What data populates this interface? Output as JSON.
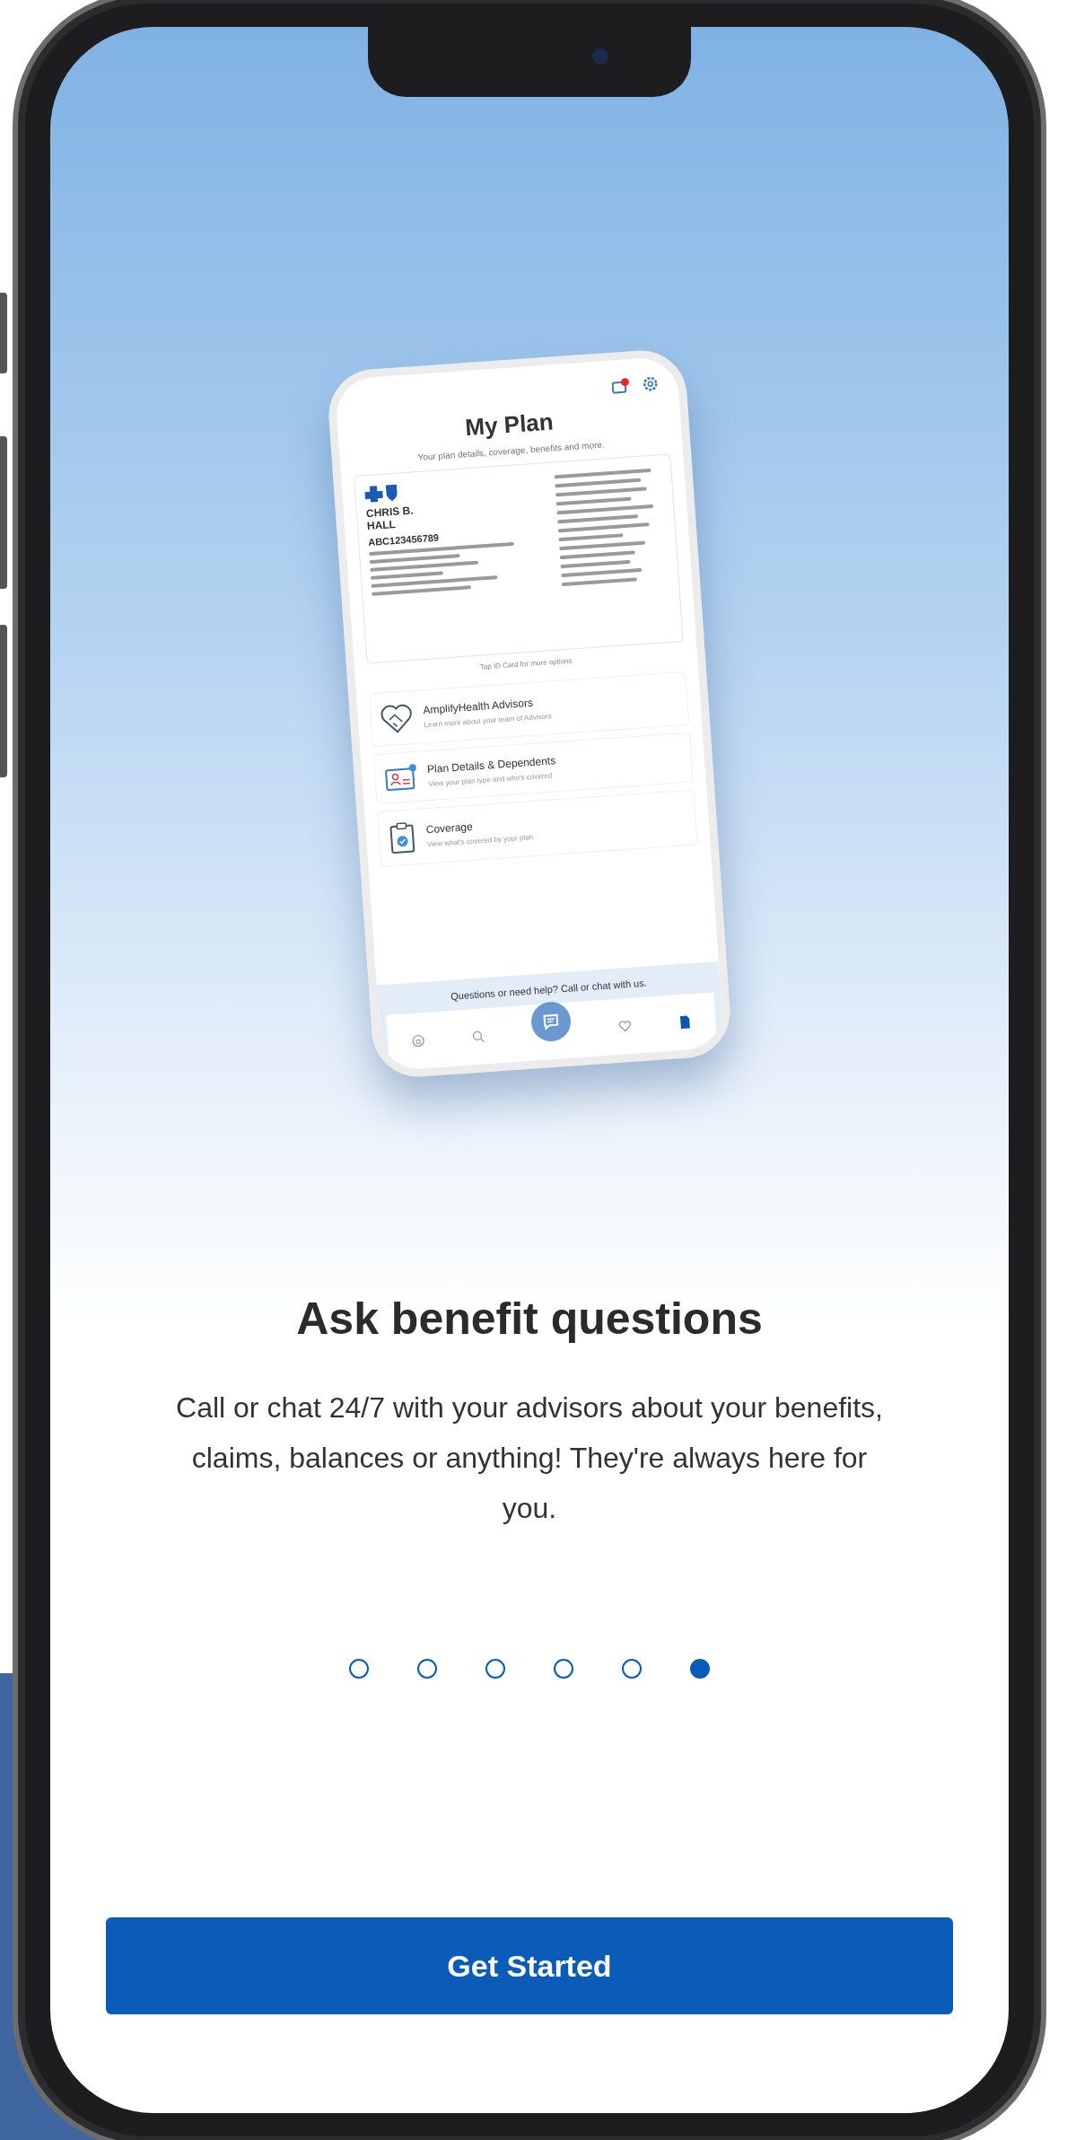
{
  "preview": {
    "title": "My Plan",
    "subtitle": "Your plan details, coverage, benefits and more.",
    "notification_badge": true,
    "id_card": {
      "name": "CHRIS B. HALL",
      "member_id": "ABC123456789"
    },
    "card_hint": "Tap ID Card for more options",
    "items": [
      {
        "kind": "advisors",
        "title": "AmplifyHealth Advisors",
        "subtitle": "Learn more about your team of Advisors"
      },
      {
        "kind": "plan",
        "title": "Plan Details & Dependents",
        "subtitle": "View your plan type and who's covered"
      },
      {
        "kind": "coverage",
        "title": "Coverage",
        "subtitle": "View what's covered by your plan"
      }
    ],
    "help": "Questions or need help? Call or chat with us.",
    "nav": [
      {
        "kind": "home",
        "selected": false
      },
      {
        "kind": "search",
        "selected": false
      },
      {
        "kind": "chat",
        "selected": false
      },
      {
        "kind": "heart",
        "selected": false
      },
      {
        "kind": "plan",
        "selected": true
      }
    ]
  },
  "heading": "Ask benefit questions",
  "description": "Call or chat 24/7 with your advisors about your benefits, claims, balances or anything! They're always here for you.",
  "pager": [
    {
      "selected": false
    },
    {
      "selected": false
    },
    {
      "selected": false
    },
    {
      "selected": false
    },
    {
      "selected": false
    },
    {
      "selected": true
    }
  ],
  "button": "Get Started"
}
